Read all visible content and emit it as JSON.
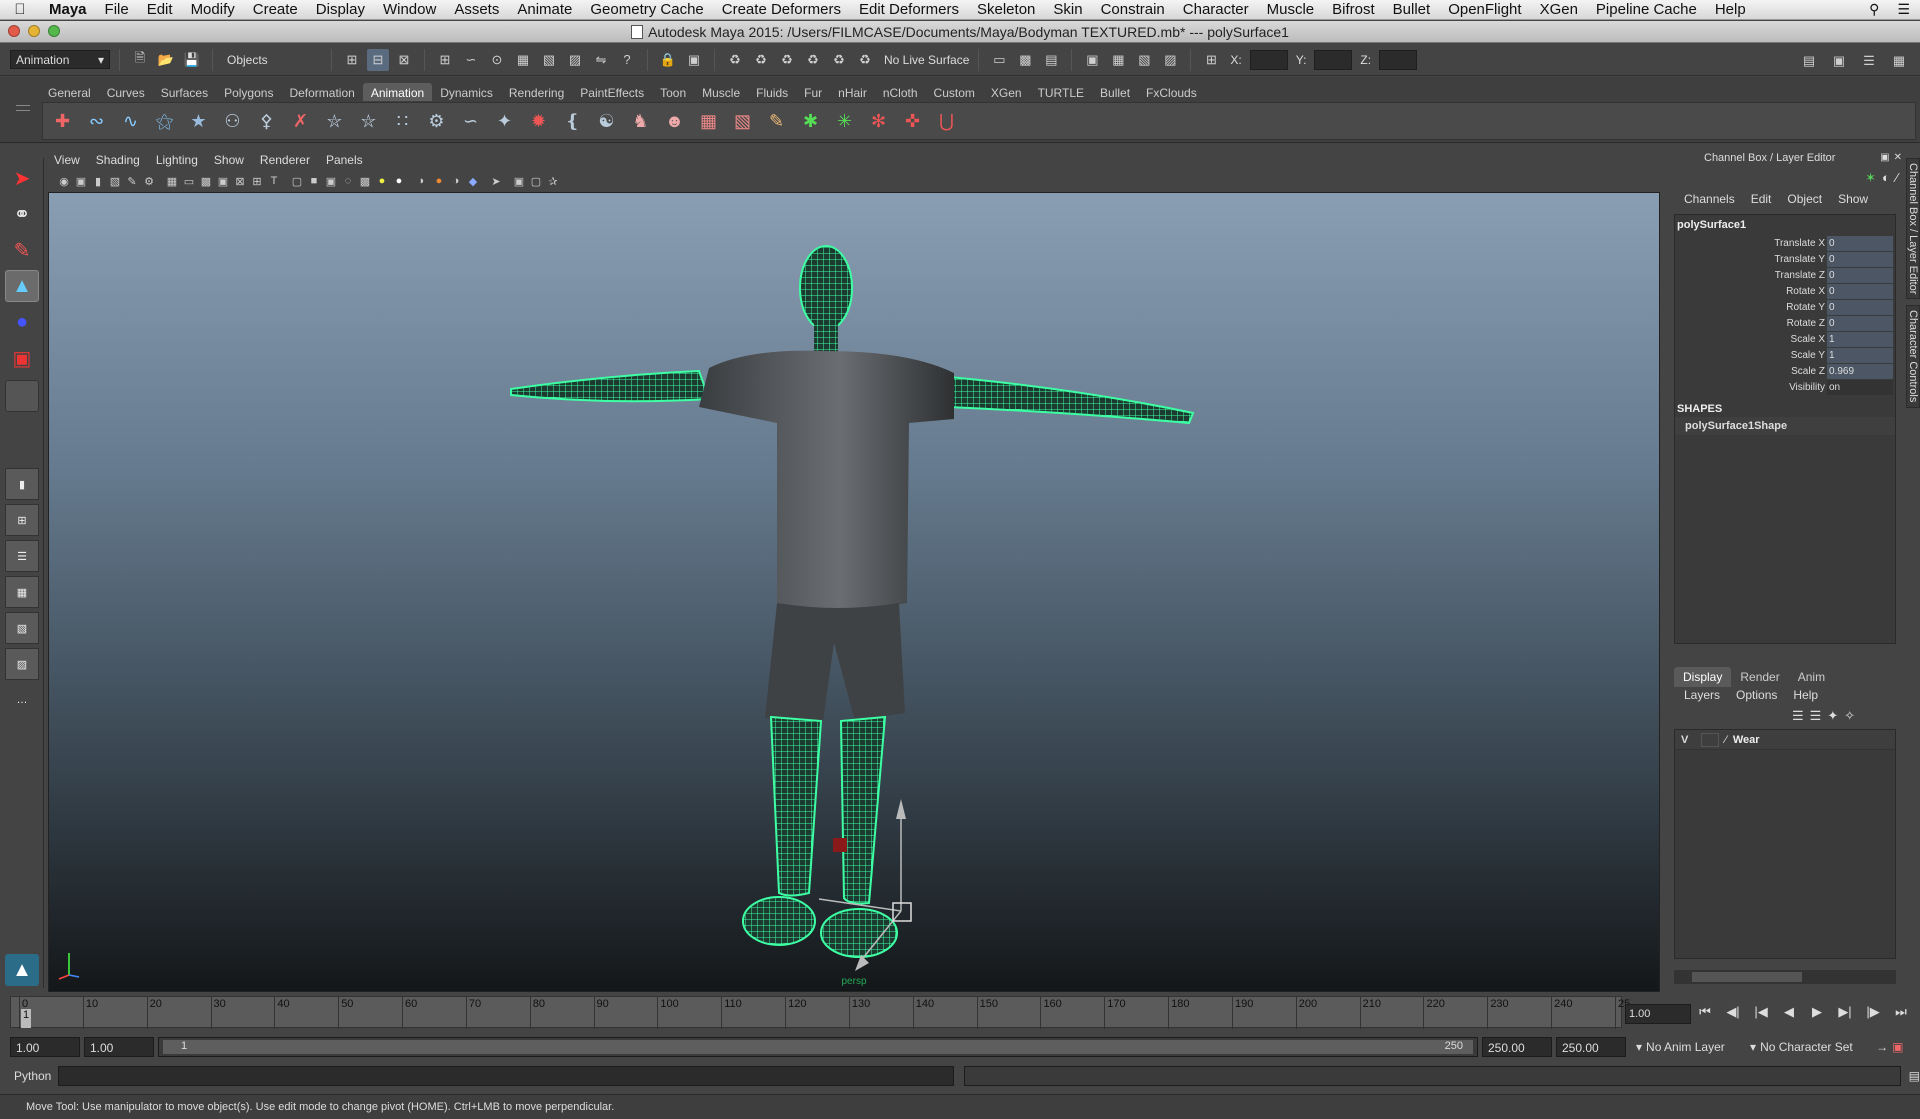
{
  "menubar": {
    "app": "Maya",
    "items": [
      "File",
      "Edit",
      "Modify",
      "Create",
      "Display",
      "Window",
      "Assets",
      "Animate",
      "Geometry Cache",
      "Create Deformers",
      "Edit Deformers",
      "Skeleton",
      "Skin",
      "Constrain",
      "Character",
      "Muscle",
      "Bifrost",
      "Bullet",
      "OpenFlight",
      "XGen",
      "Pipeline Cache",
      "Help"
    ]
  },
  "window": {
    "title": "Autodesk Maya 2015: /Users/FILMCASE/Documents/Maya/Bodyman TEXTURED.mb*  ---  polySurface1"
  },
  "statusline": {
    "menu_set": "Animation",
    "selection_mode": "Objects",
    "live_surface": "No Live Surface",
    "x_label": "X:",
    "y_label": "Y:",
    "z_label": "Z:"
  },
  "shelf": {
    "tabs": [
      "General",
      "Curves",
      "Surfaces",
      "Polygons",
      "Deformation",
      "Animation",
      "Dynamics",
      "Rendering",
      "PaintEffects",
      "Toon",
      "Muscle",
      "Fluids",
      "Fur",
      "nHair",
      "nCloth",
      "Custom",
      "XGen",
      "TURTLE",
      "Bullet",
      "FxClouds"
    ],
    "active_tab": "Animation"
  },
  "panel": {
    "menu": [
      "View",
      "Shading",
      "Lighting",
      "Show",
      "Renderer",
      "Panels"
    ],
    "camera": "persp"
  },
  "channel_box": {
    "title": "Channel Box / Layer Editor",
    "menu": [
      "Channels",
      "Edit",
      "Object",
      "Show"
    ],
    "object": "polySurface1",
    "attributes": [
      {
        "name": "Translate X",
        "value": "0"
      },
      {
        "name": "Translate Y",
        "value": "0"
      },
      {
        "name": "Translate Z",
        "value": "0"
      },
      {
        "name": "Rotate X",
        "value": "0"
      },
      {
        "name": "Rotate Y",
        "value": "0"
      },
      {
        "name": "Rotate Z",
        "value": "0"
      },
      {
        "name": "Scale X",
        "value": "1"
      },
      {
        "name": "Scale Y",
        "value": "1"
      },
      {
        "name": "Scale Z",
        "value": "0.969"
      },
      {
        "name": "Visibility",
        "value": "on"
      }
    ],
    "shapes_heading": "SHAPES",
    "shape": "polySurface1Shape"
  },
  "layer_editor": {
    "tabs": [
      "Display",
      "Render",
      "Anim"
    ],
    "active_tab": "Display",
    "menu": [
      "Layers",
      "Options",
      "Help"
    ],
    "layers": [
      {
        "visible": "V",
        "name": "Wear"
      }
    ]
  },
  "side_tabs": [
    "Channel Box / Layer Editor",
    "Character Controls"
  ],
  "timeline": {
    "ticks": [
      "0",
      "10",
      "20",
      "30",
      "40",
      "50",
      "60",
      "70",
      "80",
      "90",
      "100",
      "110",
      "120",
      "130",
      "140",
      "150",
      "160",
      "170",
      "180",
      "190",
      "200",
      "210",
      "220",
      "230",
      "240",
      "25"
    ],
    "current_marker": "1",
    "current_time": "1.00"
  },
  "range": {
    "start_time": "1.00",
    "playback_start": "1.00",
    "range_start": "1",
    "range_end": "250",
    "playback_end": "250.00",
    "end_time": "250.00",
    "anim_layer": "No Anim Layer",
    "character_set": "No Character Set"
  },
  "command_line": {
    "language": "Python"
  },
  "help_line": "Move Tool: Use manipulator to move object(s). Use edit mode to change pivot (HOME).  Ctrl+LMB to move perpendicular."
}
